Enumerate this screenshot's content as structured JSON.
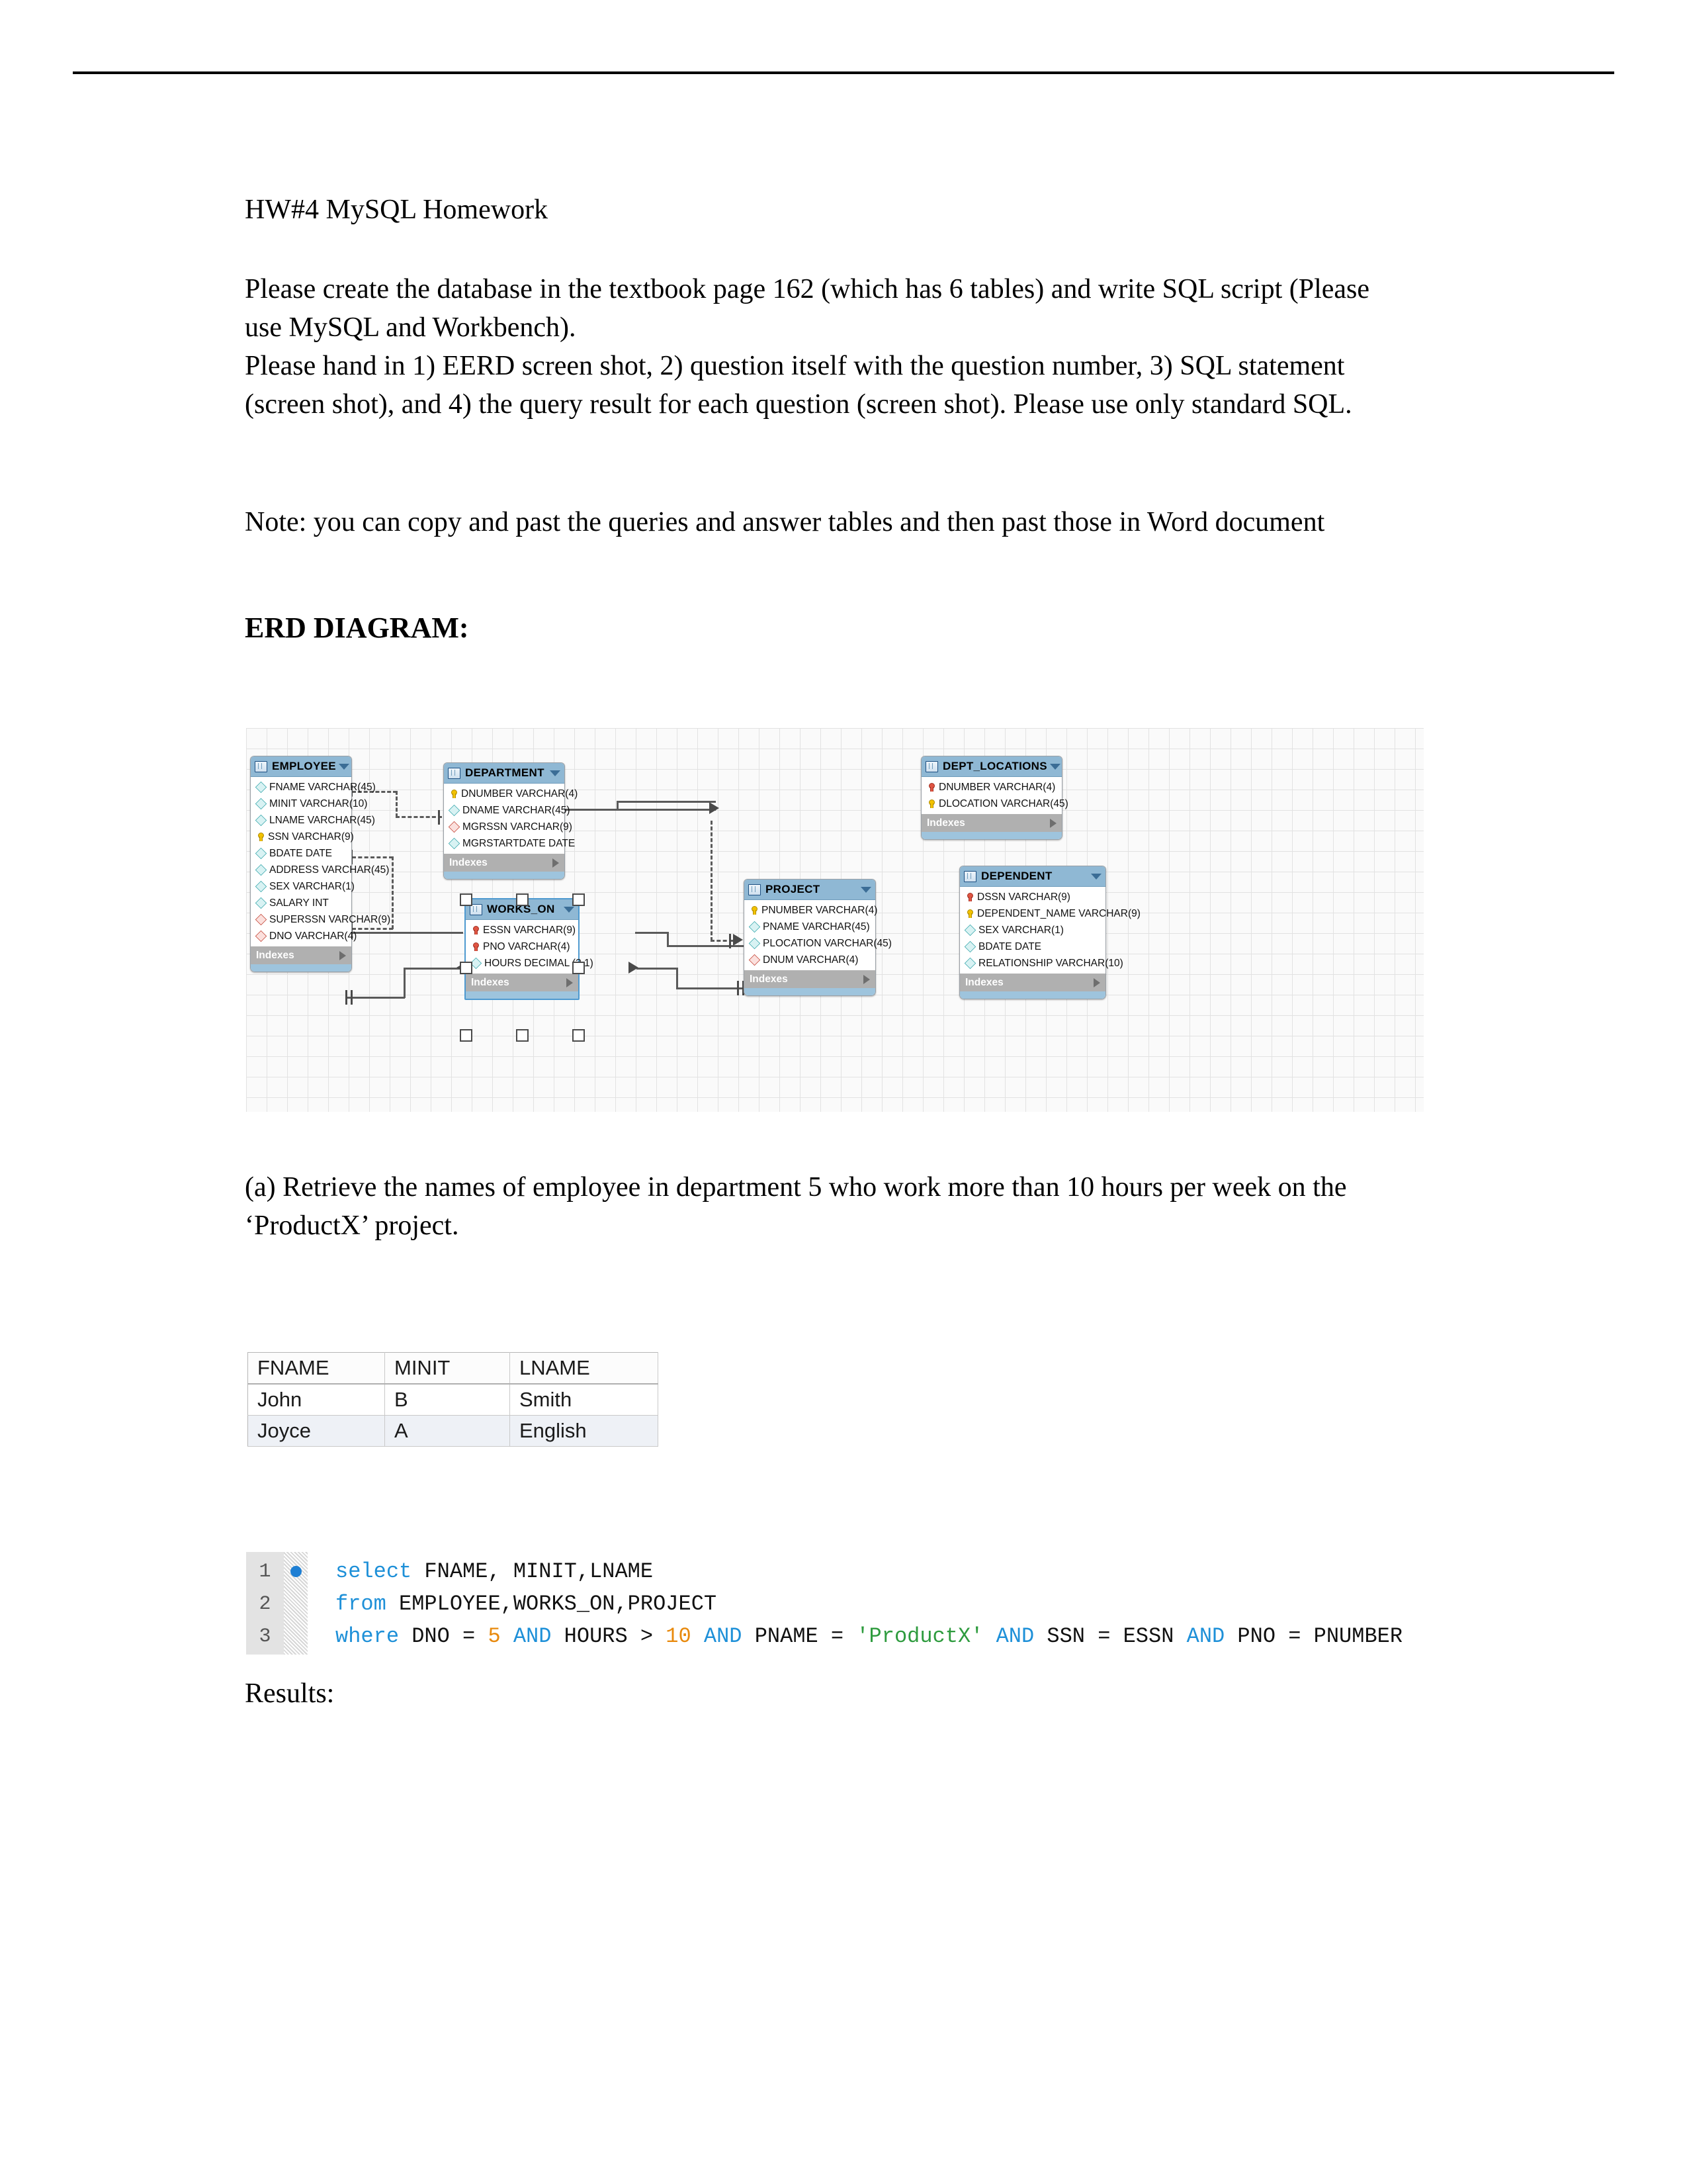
{
  "document": {
    "title": "HW#4 MySQL Homework",
    "paragraph1": "Please create the database in the textbook page 162 (which has 6 tables) and write SQL script (Please use MySQL and Workbench).\nPlease hand in 1) EERD screen shot, 2) question itself with the question number, 3) SQL statement (screen shot), and 4) the query result for each question (screen shot). Please use only standard SQL.",
    "paragraph2": "Note: you can copy and past the queries and answer tables and then past those in Word document",
    "erd_heading": "ERD DIAGRAM:",
    "question_a": "(a) Retrieve the names of employee in department 5 who work more than 10 hours per week on the ‘ProductX’ project.",
    "results_label": "Results:"
  },
  "erd": {
    "indexes_label": "Indexes",
    "tables": [
      {
        "name": "EMPLOYEE",
        "selected": false,
        "columns": [
          {
            "icon": "diamond-teal-icon",
            "text": "FNAME VARCHAR(45)"
          },
          {
            "icon": "diamond-teal-icon",
            "text": "MINIT VARCHAR(10)"
          },
          {
            "icon": "diamond-teal-icon",
            "text": "LNAME VARCHAR(45)"
          },
          {
            "icon": "key-yellow-icon",
            "text": "SSN VARCHAR(9)"
          },
          {
            "icon": "diamond-teal-icon",
            "text": "BDATE DATE"
          },
          {
            "icon": "diamond-teal-icon",
            "text": "ADDRESS VARCHAR(45)"
          },
          {
            "icon": "diamond-teal-icon",
            "text": "SEX VARCHAR(1)"
          },
          {
            "icon": "diamond-teal-icon",
            "text": "SALARY INT"
          },
          {
            "icon": "diamond-red-icon",
            "text": "SUPERSSN VARCHAR(9)"
          },
          {
            "icon": "diamond-red-icon",
            "text": "DNO VARCHAR(4)"
          }
        ]
      },
      {
        "name": "DEPARTMENT",
        "selected": false,
        "columns": [
          {
            "icon": "key-yellow-icon",
            "text": "DNUMBER VARCHAR(4)"
          },
          {
            "icon": "diamond-teal-icon",
            "text": "DNAME VARCHAR(45)"
          },
          {
            "icon": "diamond-red-icon",
            "text": "MGRSSN VARCHAR(9)"
          },
          {
            "icon": "diamond-teal-icon",
            "text": "MGRSTARTDATE DATE"
          }
        ]
      },
      {
        "name": "DEPT_LOCATIONS",
        "selected": false,
        "columns": [
          {
            "icon": "key-red-icon",
            "text": "DNUMBER VARCHAR(4)"
          },
          {
            "icon": "key-yellow-icon",
            "text": "DLOCATION VARCHAR(45)"
          }
        ]
      },
      {
        "name": "WORKS_ON",
        "selected": true,
        "columns": [
          {
            "icon": "key-red-icon",
            "text": "ESSN VARCHAR(9)"
          },
          {
            "icon": "key-red-icon",
            "text": "PNO VARCHAR(4)"
          },
          {
            "icon": "diamond-teal-icon",
            "text": "HOURS DECIMAL (3,1)"
          }
        ]
      },
      {
        "name": "PROJECT",
        "selected": false,
        "columns": [
          {
            "icon": "key-yellow-icon",
            "text": "PNUMBER VARCHAR(4)"
          },
          {
            "icon": "diamond-teal-icon",
            "text": "PNAME VARCHAR(45)"
          },
          {
            "icon": "diamond-teal-icon",
            "text": "PLOCATION VARCHAR(45)"
          },
          {
            "icon": "diamond-red-icon",
            "text": "DNUM VARCHAR(4)"
          }
        ]
      },
      {
        "name": "DEPENDENT",
        "selected": false,
        "columns": [
          {
            "icon": "key-red-icon",
            "text": "DSSN VARCHAR(9)"
          },
          {
            "icon": "key-yellow-icon",
            "text": "DEPENDENT_NAME VARCHAR(9)"
          },
          {
            "icon": "diamond-teal-icon",
            "text": "SEX VARCHAR(1)"
          },
          {
            "icon": "diamond-teal-icon",
            "text": "BDATE DATE"
          },
          {
            "icon": "diamond-teal-icon",
            "text": "RELATIONSHIP VARCHAR(10)"
          }
        ]
      }
    ]
  },
  "result_table": {
    "columns": [
      "FNAME",
      "MINIT",
      "LNAME"
    ],
    "rows": [
      [
        "John",
        "B",
        "Smith"
      ],
      [
        "Joyce",
        "A",
        "English"
      ]
    ]
  },
  "sql": {
    "lines": [
      {
        "number": "1",
        "breakpoint": true,
        "tokens": [
          {
            "t": "select ",
            "c": "kw"
          },
          {
            "t": "FNAME, MINIT,LNAME",
            "c": "id"
          }
        ]
      },
      {
        "number": "2",
        "breakpoint": false,
        "tokens": [
          {
            "t": "from ",
            "c": "kw"
          },
          {
            "t": "EMPLOYEE,WORKS_ON,PROJECT",
            "c": "id"
          }
        ]
      },
      {
        "number": "3",
        "breakpoint": false,
        "tokens": [
          {
            "t": "where ",
            "c": "kw"
          },
          {
            "t": "DNO = ",
            "c": "id"
          },
          {
            "t": "5",
            "c": "num"
          },
          {
            "t": " ",
            "c": "id"
          },
          {
            "t": "AND",
            "c": "kw"
          },
          {
            "t": " HOURS > ",
            "c": "id"
          },
          {
            "t": "10",
            "c": "num"
          },
          {
            "t": " ",
            "c": "id"
          },
          {
            "t": "AND",
            "c": "kw"
          },
          {
            "t": " PNAME = ",
            "c": "id"
          },
          {
            "t": "'ProductX'",
            "c": "str"
          },
          {
            "t": " ",
            "c": "id"
          },
          {
            "t": "AND",
            "c": "kw"
          },
          {
            "t": " SSN = ESSN ",
            "c": "id"
          },
          {
            "t": "AND",
            "c": "kw"
          },
          {
            "t": " PNO = PNUMBER",
            "c": "id"
          }
        ]
      }
    ]
  },
  "colors": {
    "table_header": "#8fb8d4",
    "indexes_bar": "#b0b0b0",
    "keyword": "#1e90d8",
    "number": "#e8890c",
    "string": "#2e9b3e"
  }
}
